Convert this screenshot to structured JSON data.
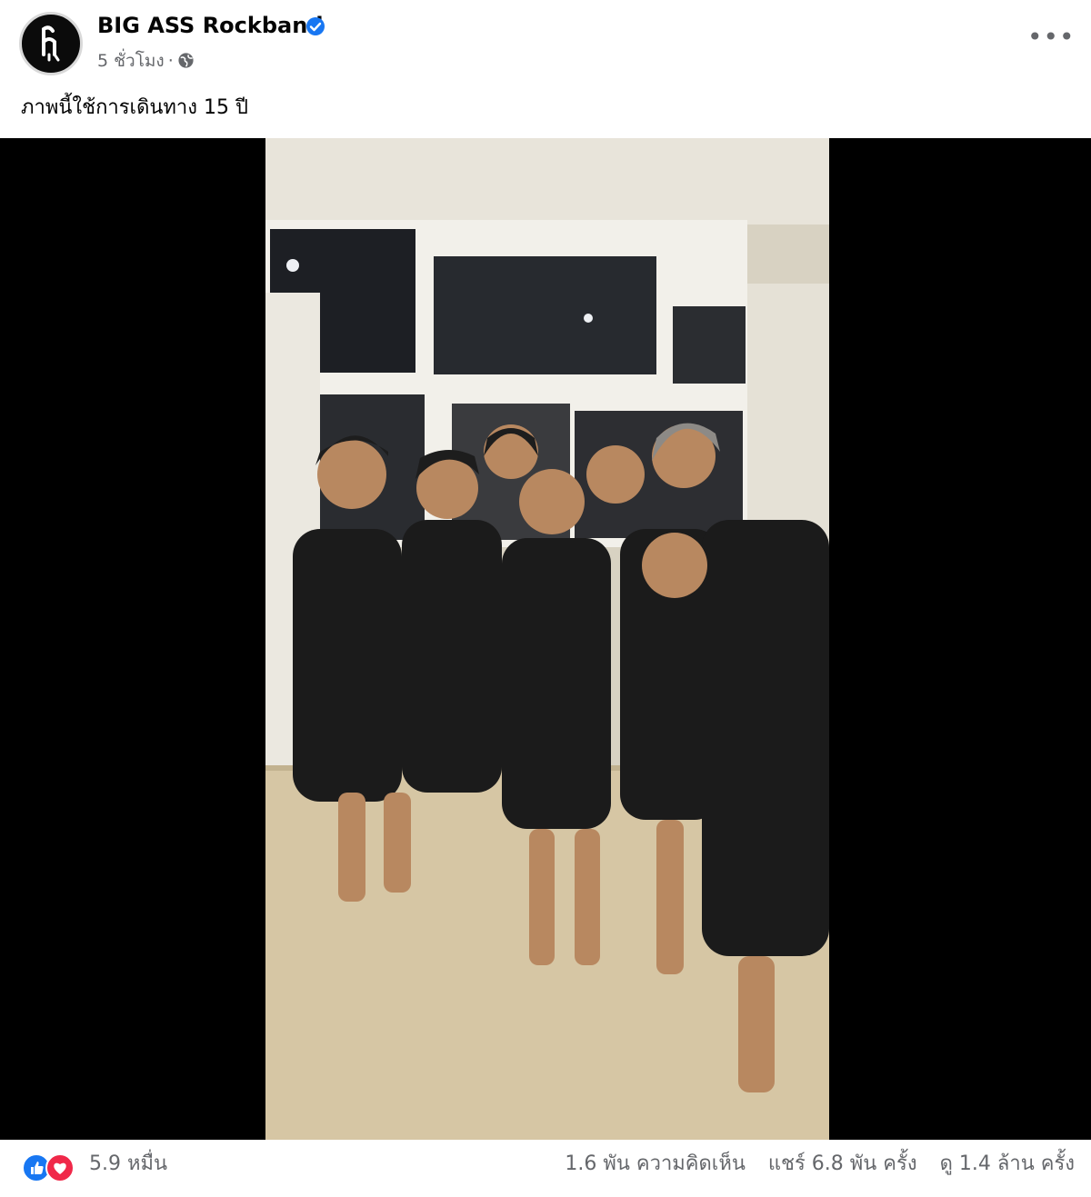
{
  "post": {
    "page_name": "BIG ASS Rockband",
    "time": "5 ชั่วโมง",
    "separator": "·",
    "caption": "ภาพนี้ใช้การเดินทาง 15 ปี"
  },
  "icons": {
    "avatar": "band-logo",
    "verified": "verified-badge-icon",
    "privacy": "globe-icon",
    "menu": "more-options-icon",
    "reaction_1": "like-icon",
    "reaction_2": "love-icon"
  },
  "colors": {
    "verified": "#1877f2",
    "like": "#1877f2",
    "love": "#f02849",
    "secondary_text": "#65676b"
  },
  "footer": {
    "reaction_count": "5.9 หมื่น",
    "comments": "1.6 พัน ความคิดเห็น",
    "shares": "แชร์ 6.8 พัน ครั้ง",
    "views": "ดู 1.4 ล้าน ครั้ง"
  }
}
